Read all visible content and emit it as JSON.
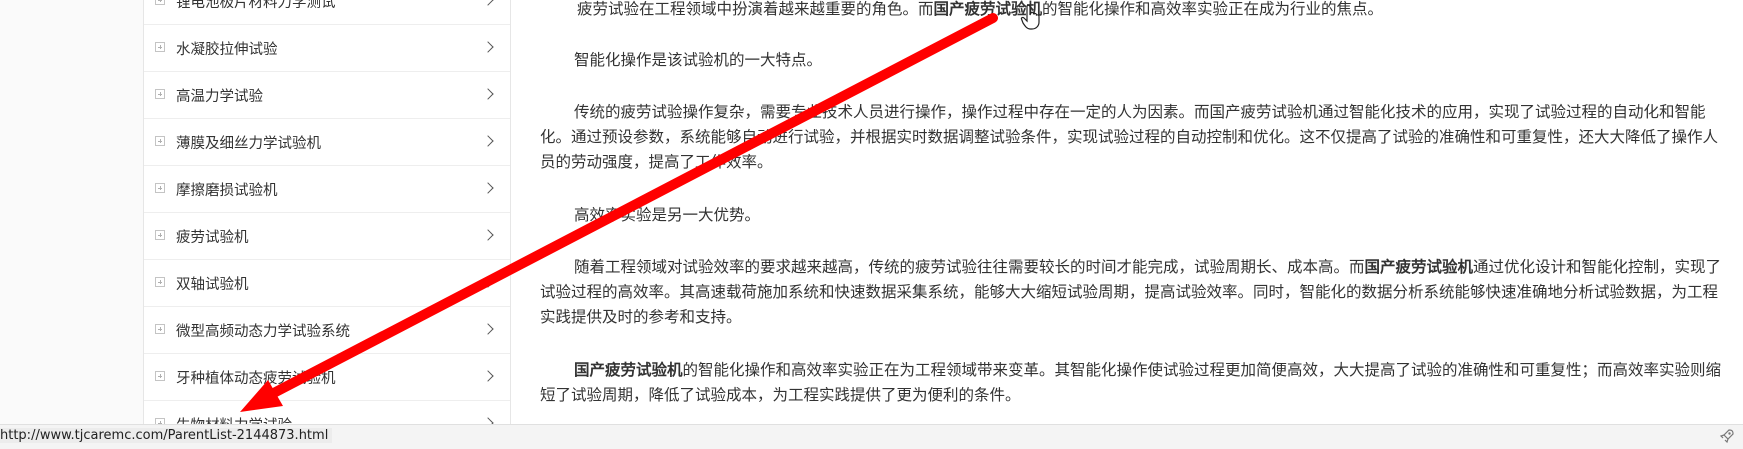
{
  "sidebar": {
    "items": [
      {
        "label": "锂电池极片材料力学测试"
      },
      {
        "label": "水凝胶拉伸试验"
      },
      {
        "label": "高温力学试验"
      },
      {
        "label": "薄膜及细丝力学试验机"
      },
      {
        "label": "摩擦磨损试验机"
      },
      {
        "label": "疲劳试验机"
      },
      {
        "label": "双轴试验机"
      },
      {
        "label": "微型高频动态力学试验系统"
      },
      {
        "label": "牙种植体动态疲劳试验机"
      },
      {
        "label": "生物材料力学试验"
      }
    ]
  },
  "article": {
    "p1": {
      "a": "疲劳试验在工程领域中扮演着越来越重要的角色。而",
      "bold": "国产疲劳试验机",
      "c": "的智能化操作和高效率实验正在成为行业的焦点。"
    },
    "p2": "智能化操作是该试验机的一大特点。",
    "p3": "传统的疲劳试验操作复杂，需要专业技术人员进行操作，操作过程中存在一定的人为因素。而国产疲劳试验机通过智能化技术的应用，实现了试验过程的自动化和智能化。通过预设参数，系统能够自动进行试验，并根据实时数据调整试验条件，实现试验过程的自动控制和优化。这不仅提高了试验的准确性和可重复性，还大大降低了操作人员的劳动强度，提高了工作效率。",
    "p4": "高效率实验是另一大优势。",
    "p5": {
      "a": "随着工程领域对试验效率的要求越来越高，传统的疲劳试验往往需要较长的时间才能完成，试验周期长、成本高。而",
      "bold": "国产疲劳试验机",
      "c": "通过优化设计和智能化控制，实现了试验过程的高效率。其高速载荷施加系统和快速数据采集系统，能够大大缩短试验周期，提高试验效率。同时，智能化的数据分析系统能够快速准确地分析试验数据，为工程实践提供及时的参考和支持。"
    },
    "p6": {
      "bold": "国产疲劳试验机",
      "c": "的智能化操作和高效率实验正在为工程领域带来变革。其智能化操作使试验过程更加简便高效，大大提高了试验的准确性和可重复性；而高效率实验则缩短了试验周期，降低了试验成本，为工程实践提供了更为便利的条件。"
    }
  },
  "status_bar": {
    "url": "http://www.tjcaremc.com/ParentList-2144873.html"
  },
  "icons": {
    "cursor": "hand-pointer-icon",
    "status_right": "rocket-icon",
    "expand": "plus-box-icon",
    "chevron": "chevron-right-icon"
  },
  "annotation": {
    "type": "arrow",
    "color": "#ff0000"
  }
}
